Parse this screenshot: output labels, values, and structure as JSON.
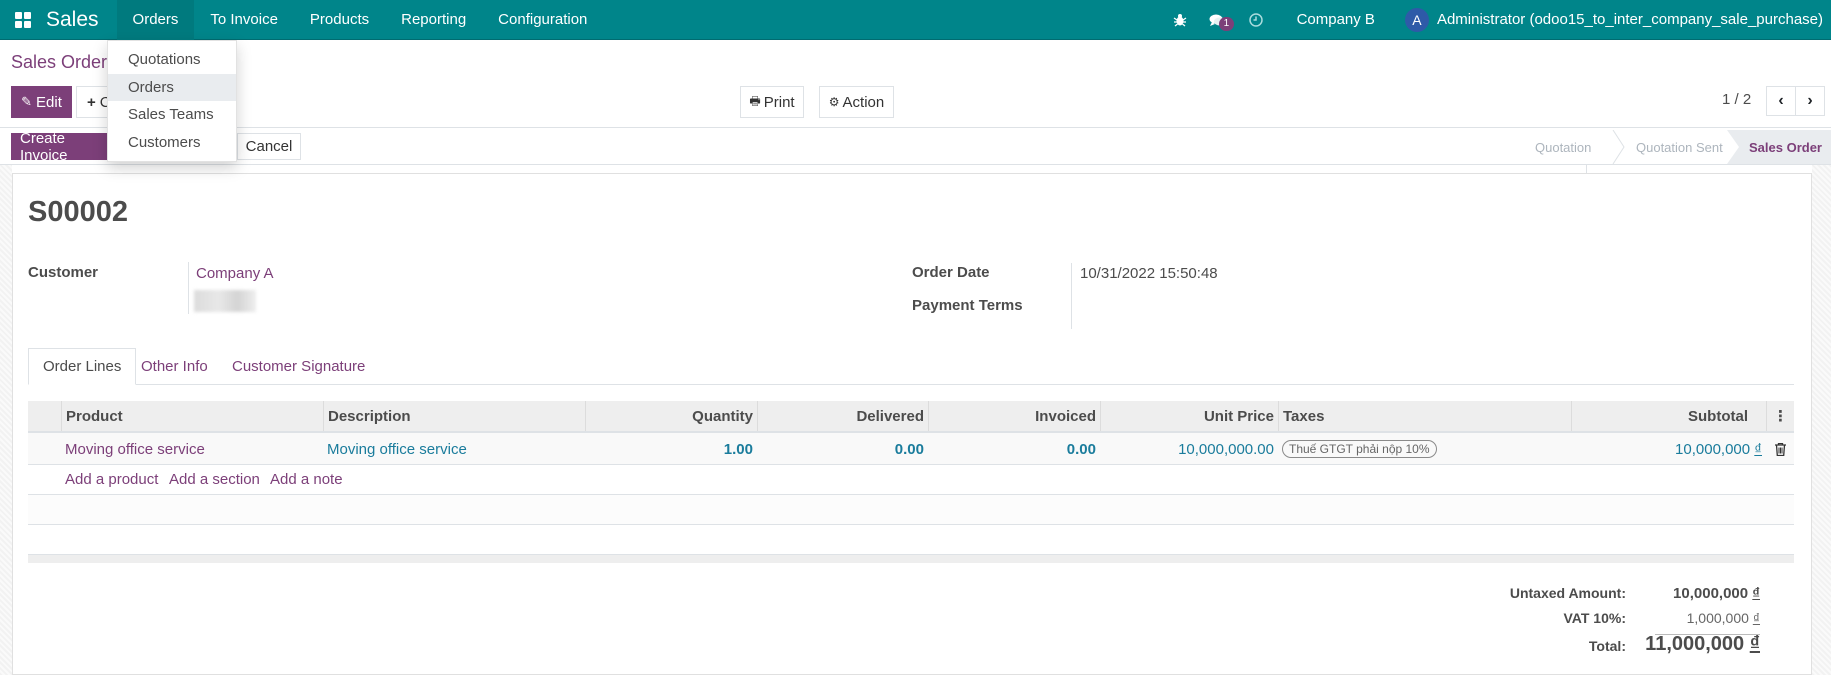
{
  "navbar": {
    "app_name": "Sales",
    "menu": [
      "Orders",
      "To Invoice",
      "Products",
      "Reporting",
      "Configuration"
    ],
    "open_menu": "Orders",
    "chat_badge": "1",
    "company": "Company B",
    "avatar_letter": "A",
    "user": "Administrator (odoo15_to_inter_company_sale_purchase)",
    "icons": {
      "apps": "apps-grid-icon",
      "debug": "bug-icon",
      "chat": "chat-icon",
      "activity": "clock-icon"
    },
    "color": "#00858a"
  },
  "dropdown": {
    "items": [
      "Quotations",
      "Orders",
      "Sales Teams",
      "Customers"
    ],
    "hovered": "Orders"
  },
  "control_panel": {
    "breadcrumb": "Sales Orders",
    "edit_label": "Edit",
    "create_label": "Create",
    "print_label": "Print",
    "action_label": "Action",
    "pager": "1 / 2"
  },
  "header_buttons": {
    "create_invoice": "Create Invoice",
    "cancel": "Cancel"
  },
  "statusbar": {
    "steps": [
      "Quotation",
      "Quotation Sent",
      "Sales Order"
    ],
    "active": "Sales Order"
  },
  "form": {
    "title": "S00002",
    "customer_label": "Customer",
    "customer_value": "Company A",
    "order_date_label": "Order Date",
    "order_date_value": "10/31/2022 15:50:48",
    "payment_terms_label": "Payment Terms",
    "payment_terms_value": ""
  },
  "tabs": [
    "Order Lines",
    "Other Info",
    "Customer Signature"
  ],
  "active_tab": "Order Lines",
  "order_lines": {
    "columns": [
      "Product",
      "Description",
      "Quantity",
      "Delivered",
      "Invoiced",
      "Unit Price",
      "Taxes",
      "Subtotal"
    ],
    "rows": [
      {
        "product": "Moving office service",
        "description": "Moving office service",
        "quantity": "1.00",
        "delivered": "0.00",
        "invoiced": "0.00",
        "unit_price": "10,000,000.00",
        "taxes": "Thuế GTGT phải nộp 10%",
        "subtotal": "10,000,000",
        "currency": "₫"
      }
    ],
    "add_links": [
      "Add a product",
      "Add a section",
      "Add a note"
    ]
  },
  "totals": {
    "untaxed_label": "Untaxed Amount:",
    "untaxed_value": "10,000,000",
    "vat_label": "VAT 10%:",
    "vat_value": "1,000,000",
    "total_label": "Total:",
    "total_value": "11,000,000",
    "currency": "₫"
  },
  "colors": {
    "brand": "#7c3f79",
    "link_teal": "#1a7c9c"
  }
}
